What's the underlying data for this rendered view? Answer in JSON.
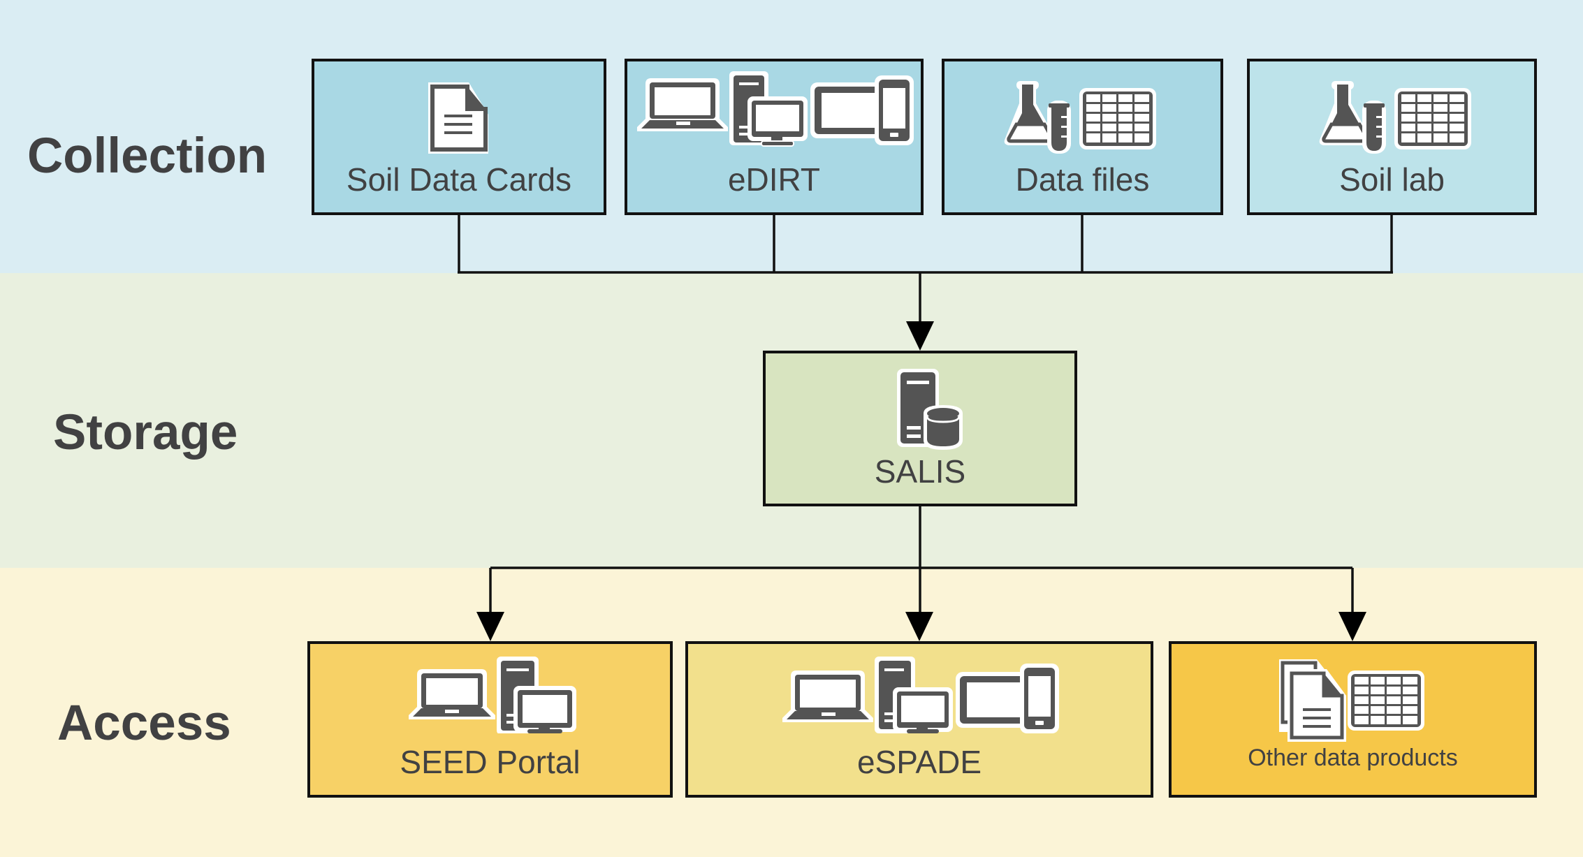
{
  "diagram": {
    "type": "data-flow",
    "stages": [
      {
        "id": "collection",
        "label": "Collection",
        "color": "#daedf3"
      },
      {
        "id": "storage",
        "label": "Storage",
        "color": "#e9f0df"
      },
      {
        "id": "access",
        "label": "Access",
        "color": "#fbf4d7"
      }
    ],
    "collection_nodes": [
      {
        "id": "soil-data-cards",
        "label": "Soil Data Cards",
        "icon": "document-icon",
        "fill": "#a9d8e4"
      },
      {
        "id": "edirt",
        "label": "eDIRT",
        "icon": "devices-icon",
        "fill": "#a9d8e4"
      },
      {
        "id": "data-files",
        "label": "Data files",
        "icon": "lab-and-table-icon",
        "fill": "#a9d8e4"
      },
      {
        "id": "soil-lab",
        "label": "Soil lab",
        "icon": "lab-and-table-icon",
        "fill": "#bde3ea"
      }
    ],
    "storage_nodes": [
      {
        "id": "salis",
        "label": "SALIS",
        "icon": "server-database-icon",
        "fill": "#d8e4c0"
      }
    ],
    "access_nodes": [
      {
        "id": "seed-portal",
        "label": "SEED Portal",
        "icon": "computers-icon",
        "fill": "#f7d166"
      },
      {
        "id": "espade",
        "label": "eSPADE",
        "icon": "devices-icon",
        "fill": "#f2e08c"
      },
      {
        "id": "other-data-products",
        "label": "Other data products",
        "icon": "documents-and-table-icon",
        "fill": "#f6c748"
      }
    ],
    "edges": [
      {
        "from": "soil-data-cards",
        "to": "salis"
      },
      {
        "from": "edirt",
        "to": "salis"
      },
      {
        "from": "data-files",
        "to": "salis"
      },
      {
        "from": "soil-lab",
        "to": "salis"
      },
      {
        "from": "salis",
        "to": "seed-portal"
      },
      {
        "from": "salis",
        "to": "espade"
      },
      {
        "from": "salis",
        "to": "other-data-products"
      }
    ],
    "colors": {
      "text": "#414142",
      "icon": "#545454",
      "line": "#111111"
    }
  }
}
